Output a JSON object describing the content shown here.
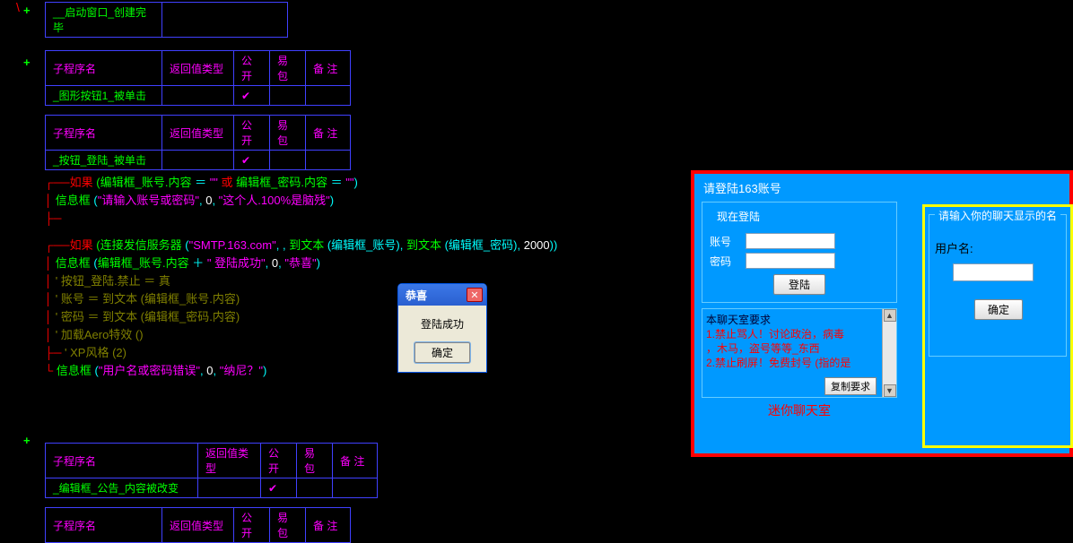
{
  "tables": {
    "t1_row": "__启动窗口_创建完毕",
    "headers": {
      "name": "子程序名",
      "ret": "返回值类型",
      "pub": "公开",
      "pkg": "易包",
      "note": "备 注"
    },
    "t2_row": "_图形按钮1_被单击",
    "t3_row": "_按钮_登陆_被单击",
    "t4_row": "_编辑框_公告_内容被改变"
  },
  "code": {
    "l1a": "如果",
    "l1b": "(编辑框_账号.内容",
    "l1c": " ＝ ",
    "l1d": "\"\"",
    "l1e": " 或 ",
    "l1f": "编辑框_密码.内容",
    "l1g": " ＝ ",
    "l1h": "\"\"",
    "l1i": ")",
    "l2a": "信息框",
    "l2b": "(",
    "l2c": "\"请输入账号或密码\"",
    "l2d": ", ",
    "l2e": "0",
    "l2f": ", ",
    "l2g": "\"这个人.100%是脑残\"",
    "l2h": ")",
    "l3a": "如果",
    "l3b": "(连接发信服务器",
    "l3c": "(",
    "l3d": "\"SMTP.163.com\"",
    "l3e": ", , ",
    "l3f": "到文本",
    "l3g": "(编辑框_账号)",
    "l3h": ", ",
    "l3i": "到文本",
    "l3j": "(编辑框_密码)",
    "l3k": ", ",
    "l3l": "2000",
    "l3m": "))",
    "l4a": "信息框",
    "l4b": "(",
    "l4c": "编辑框_账号.内容",
    "l4d": " ＋ ",
    "l4e": "\" 登陆成功\"",
    "l4f": ", ",
    "l4g": "0",
    "l4h": ", ",
    "l4i": "\"恭喜\"",
    "l4j": ")",
    "l5": "' 按钮_登陆.禁止 ＝ 真",
    "l6": "' 账号 ＝ 到文本 (编辑框_账号.内容)",
    "l7": "' 密码 ＝ 到文本 (编辑框_密码.内容)",
    "l8": "' 加载Aero特效 ()",
    "l9": "' XP风格 (2)",
    "l10a": "信息框",
    "l10b": "(",
    "l10c": "\"用户名或密码错误\"",
    "l10d": ", ",
    "l10e": "0",
    "l10f": ", ",
    "l10g": "\"纳尼？\"",
    "l10h": ")"
  },
  "dialog": {
    "title": "恭喜",
    "msg": "登陆成功",
    "ok": "确定"
  },
  "right": {
    "title": "请登陆163账号",
    "fieldset": "现在登陆",
    "acc": "账号",
    "pwd": "密码",
    "login": "登陆",
    "notice1": "本聊天室要求",
    "notice2": "1.禁止骂人！讨论政治，病毒",
    "notice3": "，木马，盗号等等_东西",
    "notice4": "2.禁止刷屏！免费封号 (指的是",
    "copy": "复制要求",
    "footer": "迷你聊天室"
  },
  "inner": {
    "title": "请输入你的聊天显示的名",
    "user": "用户名:",
    "ok": "确定"
  },
  "check": "✔"
}
